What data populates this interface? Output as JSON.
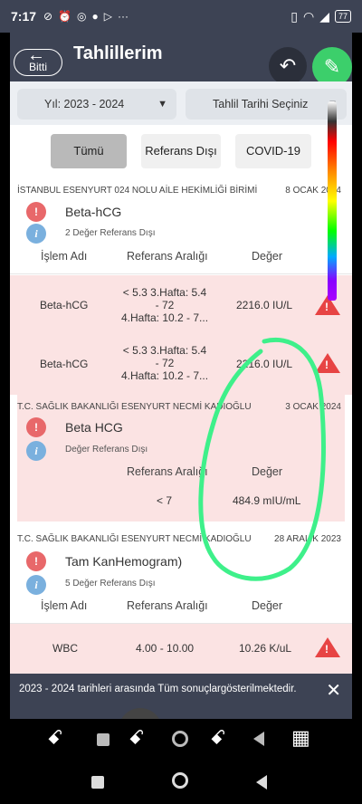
{
  "status_bar": {
    "time": "7:17",
    "battery": "77"
  },
  "app_bar": {
    "back_label": "Bitti",
    "title": "Tahlillerim"
  },
  "filters": {
    "year_select": "Yıl: 2023 - 2024",
    "date_select": "Tahlil Tarihi Seçiniz",
    "chips": [
      "Tümü",
      "Referans Dışı",
      "COVID-19"
    ],
    "active_chip": "Tümü"
  },
  "columns": {
    "name": "İşlem Adı",
    "range": "Referans Aralığı",
    "value": "Değer"
  },
  "labs": [
    {
      "institution": "İSTANBUL ESENYURT 024 NOLU AİLE HEKİMLİĞİ BİRİMİ",
      "date": "8 OCAK 2024",
      "test": "Beta-hCG",
      "summary": "2 Değer Referans Dışı",
      "rows": [
        {
          "name": "Beta-hCG",
          "range_line1": "< 5.3  3.Hafta: 5.4",
          "range_line2": "- 72",
          "range_line3": "4.Hafta: 10.2 - 7...",
          "value": "2216.0 IU/L"
        },
        {
          "name": "Beta-hCG",
          "range_line1": "< 5.3  3.Hafta: 5.4",
          "range_line2": "- 72",
          "range_line3": "4.Hafta: 10.2 - 7...",
          "value": "2216.0 IU/L"
        }
      ]
    },
    {
      "institution": "T.C. SAĞLIK BAKANLIĞI ESENYURT NECMİ KADIOĞLU",
      "date": "3 OCAK 2024",
      "test": "Beta HCG",
      "summary": "Değer Referans Dışı",
      "rows": [
        {
          "range": "< 7",
          "value": "484.9 mIU/mL"
        }
      ]
    },
    {
      "institution": "T.C. SAĞLIK BAKANLIĞI ESENYURT NECMİ KADIOĞLU",
      "date": "28 ARALIK 2023",
      "test": "Tam KanHemogram)",
      "summary": "5 Değer Referans Dışı",
      "rows": [
        {
          "name": "WBC",
          "range": "4.00 - 10.00",
          "value": "10.26 K/uL"
        }
      ]
    }
  ],
  "toast": {
    "message": "2023 - 2024 tarihleri arasında Tüm sonuçlargösterilmektedir."
  },
  "colors": {
    "header": "#3d4354",
    "alert_row": "#fbe3e3",
    "warning": "#e74444",
    "edit_button": "#3ccf6b",
    "annotation": "#3ef08a"
  }
}
